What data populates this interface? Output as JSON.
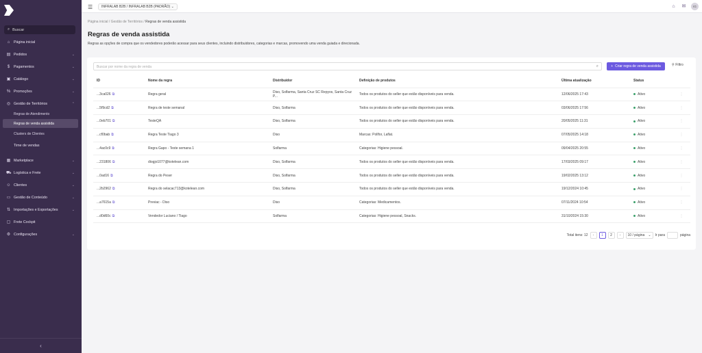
{
  "sidebar": {
    "search_label": "Buscar",
    "items": [
      {
        "label": "Página inicial",
        "icon": "home-icon"
      },
      {
        "label": "Pedidos",
        "icon": "orders-icon"
      },
      {
        "label": "Pagamentos",
        "icon": "dollar-icon"
      },
      {
        "label": "Catálogo",
        "icon": "catalog-icon"
      },
      {
        "label": "Promoções",
        "icon": "percent-icon"
      },
      {
        "label": "Gestão de Territórios",
        "icon": "globe-icon"
      },
      {
        "label": "Time de vendas",
        "icon": "team-icon"
      },
      {
        "label": "Marketplace",
        "icon": "marketplace-icon"
      },
      {
        "label": "Logística e Frete",
        "icon": "truck-icon"
      },
      {
        "label": "Clientes",
        "icon": "clients-icon"
      },
      {
        "label": "Gestão de Conteúdo",
        "icon": "content-icon"
      },
      {
        "label": "Importações e Exportações",
        "icon": "import-icon"
      },
      {
        "label": "Frete Cockpit",
        "icon": "cockpit-icon"
      },
      {
        "label": "Configurações",
        "icon": "settings-icon"
      }
    ],
    "sub_items": [
      {
        "label": "Regras de Atendimento"
      },
      {
        "label": "Regras de venda assistida"
      },
      {
        "label": "Clusters de Clientes"
      }
    ]
  },
  "topbar": {
    "store_select": "INFRALAB B2B / INFRALAB B2B (PADRÃO)",
    "avatar_initials": "IG"
  },
  "breadcrumb": [
    "Página inicial",
    "Gestão de Territórios",
    "Regras de venda assistida"
  ],
  "page": {
    "title": "Regras de venda assistida",
    "description": "Regras as opções de compra que os vendedores poderão acessar para seus clientes, incluindo distribuidores, categorias e marcas, promovendo uma venda guiada e direcionada."
  },
  "list": {
    "search_placeholder": "Buscar por nome da regra de venda",
    "create_label": "Criar regra de venda assistida",
    "filter_label": "Filtro",
    "columns": [
      "ID",
      "Nome da regra",
      "Distribuidor",
      "Definição de produtos",
      "Última atualização",
      "Status"
    ],
    "rows": [
      {
        "id": "...3ca026",
        "name": "Regra geral",
        "dist": "Diso, Solfarma, Santa Cruz SC Repyos, Santa Cruz P...",
        "def": "Todos os produtos do seller que estão disponíveis para venda.",
        "date": "12/06/2025 17:43",
        "status": "Ativo"
      },
      {
        "id": "...5f9cd2",
        "name": "Regra de teste semanal",
        "dist": "Diso, Solfarma",
        "def": "Todos os produtos do seller que estão disponíveis para venda.",
        "date": "03/06/2025 17:56",
        "status": "Ativo"
      },
      {
        "id": "...0eb701",
        "name": "TesteQA",
        "dist": "Diso, Solfarma",
        "def": "Todos os produtos do seller que estão disponíveis para venda.",
        "date": "20/05/2025 11:31",
        "status": "Ativo"
      },
      {
        "id": "...cf0bab",
        "name": "Regra Teste Tiago 3",
        "dist": "Diso",
        "def": "Marcas: Pollfor, Laflat.",
        "date": "07/05/2025 14:18",
        "status": "Ativo"
      },
      {
        "id": "...4ac0c9",
        "name": "Regra Gapo - Teste semana 1",
        "dist": "Solfarma",
        "def": "Categorias: Higiene pessoal.",
        "date": "09/04/2025 20:55",
        "status": "Ativo"
      },
      {
        "id": "...231806",
        "name": "diogjo1077@kotelean.com",
        "dist": "Diso, Solfarma",
        "def": "Todos os produtos do seller que estão disponíveis para venda.",
        "date": "17/03/2025 09:17",
        "status": "Ativo"
      },
      {
        "id": "...0ad16",
        "name": "Regra do Peser",
        "dist": "Diso, Solfarma",
        "def": "Todos os produtos do seller que estão disponíveis para venda.",
        "date": "19/02/2025 13:12",
        "status": "Ativo"
      },
      {
        "id": "...2b2962",
        "name": "Regra do selacac713@kotelean.com",
        "dist": "Diso, Solfarma",
        "def": "Todos os produtos do seller que estão disponíveis para venda.",
        "date": "19/12/2024 10:45",
        "status": "Ativo"
      },
      {
        "id": "...a7615a",
        "name": "Previac - Diso",
        "dist": "Diso",
        "def": "Categorias: Medicamentos.",
        "date": "07/11/2024 10:54",
        "status": "Ativo"
      },
      {
        "id": "...d0d60c",
        "name": "Vendedor Luciano / Tiago",
        "dist": "Solfarma",
        "def": "Categorias: Higiene pessoal, Snacks.",
        "date": "31/10/2024 15:30",
        "status": "Ativo"
      }
    ]
  },
  "pagination": {
    "total_label": "Total itens: 12",
    "pages": [
      "1",
      "2"
    ],
    "page_size": "10 / página",
    "goto_label": "Ir para",
    "page_suffix": "página"
  },
  "colors": {
    "sidebar_bg": "#3a2d4d",
    "accent": "#6c5ae0",
    "status_green": "#3aa06a"
  }
}
